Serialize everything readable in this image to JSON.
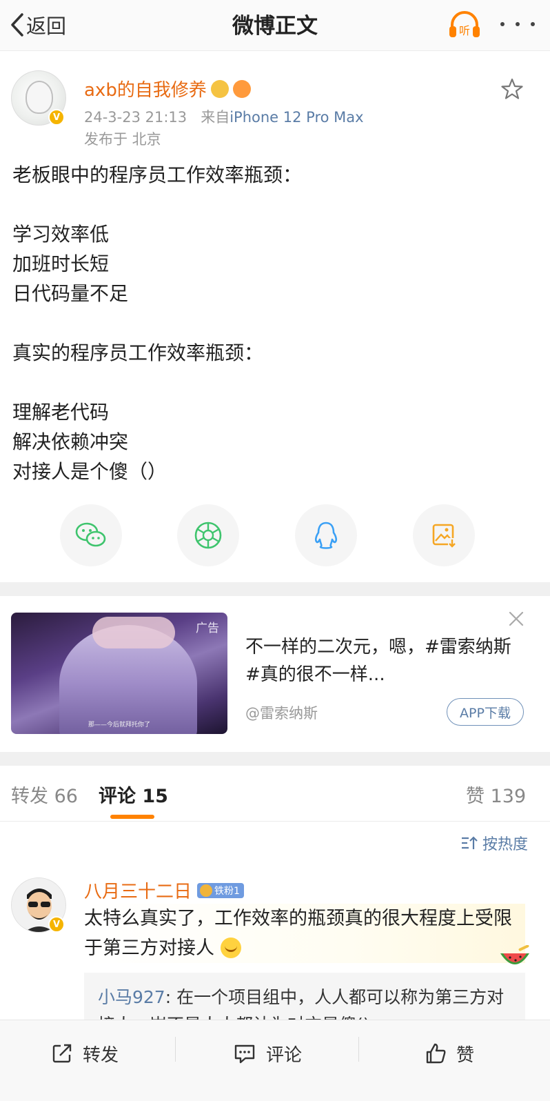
{
  "nav": {
    "back_label": "返回",
    "title": "微博正文",
    "listen_label": "听"
  },
  "post": {
    "username": "axb的自我修养",
    "timestamp": "24-3-23 21:13",
    "source_prefix": "来自",
    "device": "iPhone 12 Pro Max",
    "location": "发布于 北京",
    "lines": [
      "老板眼中的程序员工作效率瓶颈：",
      "",
      "学习效率低",
      "加班时长短",
      "日代码量不足",
      "",
      "真实的程序员工作效率瓶颈：",
      "",
      "理解老代码",
      "解决依赖冲突",
      "对接人是个傻（）"
    ]
  },
  "share": [
    {
      "icon": "wechat-icon",
      "color": "#3ec46d"
    },
    {
      "icon": "moments-icon",
      "color": "#3ec46d"
    },
    {
      "icon": "qq-icon",
      "color": "#3aa0f5"
    },
    {
      "icon": "save-image-icon",
      "color": "#f5a623"
    }
  ],
  "ad": {
    "tag": "广告",
    "subtitle": "那——今后就拜托你了",
    "text": "不一样的二次元，嗯，#雷索纳斯#真的很不一样...",
    "handle": "@雷索纳斯",
    "button": "APP下载"
  },
  "tabs": {
    "repost": "转发 66",
    "comments": "评论 15",
    "likes": "赞 139",
    "sort": "按热度"
  },
  "comment": {
    "name": "八月三十二日",
    "badge": "铁粉1",
    "text": "太特么真实了，工作效率的瓶颈真的很大程度上受限于第三方对接人",
    "reply_user": "小马927",
    "reply_text": "在一个项目组中，人人都可以称为第三方对接人，岂不是人人都认为对方是傻()"
  },
  "bottom": {
    "repost": "转发",
    "comment": "评论",
    "like": "赞"
  },
  "colors": {
    "accent": "#ff8200",
    "username": "#e86b13",
    "link": "#5a7ca6"
  }
}
